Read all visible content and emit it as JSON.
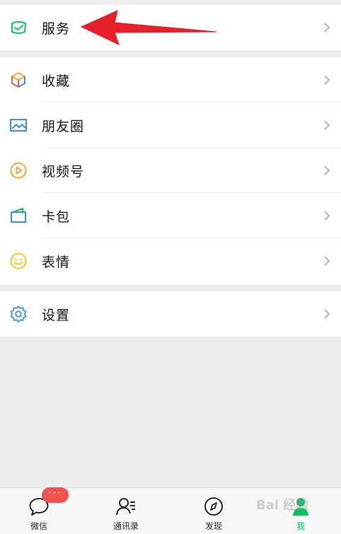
{
  "menu": {
    "services": "服务",
    "favorites": "收藏",
    "moments": "朋友圈",
    "channels": "视频号",
    "cards": "卡包",
    "stickers": "表情",
    "settings": "设置"
  },
  "tabbar": {
    "chats": "微信",
    "contacts": "通讯录",
    "discover": "发现",
    "me": "我",
    "chats_badge": "···"
  },
  "watermark": "Bai 经验",
  "colors": {
    "accent": "#07c160",
    "arrow": "#e8202a",
    "badge": "#f0524f",
    "background": "#ededed"
  },
  "icons": {
    "services": "wallet-check-icon",
    "favorites": "cube-icon",
    "moments": "picture-icon",
    "channels": "play-circle-icon",
    "cards": "card-wallet-icon",
    "stickers": "smiley-icon",
    "settings": "gear-icon"
  }
}
